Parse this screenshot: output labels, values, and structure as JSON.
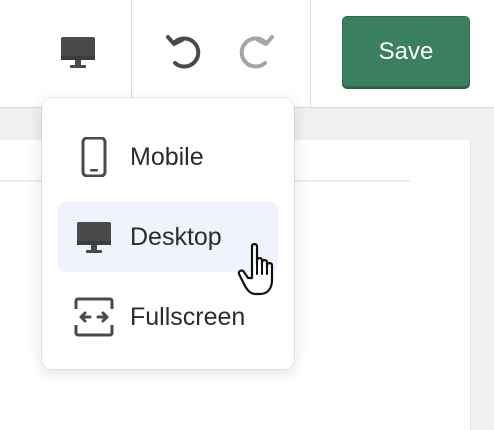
{
  "toolbar": {
    "device_icon": "desktop-icon",
    "undo_icon": "undo-icon",
    "redo_icon": "redo-icon",
    "save_label": "Save"
  },
  "device_menu": {
    "items": [
      {
        "label": "Mobile",
        "icon": "mobile-icon",
        "selected": false
      },
      {
        "label": "Desktop",
        "icon": "desktop-icon",
        "selected": true
      },
      {
        "label": "Fullscreen",
        "icon": "fullscreen-icon",
        "selected": false
      }
    ]
  },
  "colors": {
    "save_button": "#3a7f5e",
    "selected_indicator": "#3a6fd8",
    "selected_bg": "#eef3fc",
    "icon": "#4a4a4d"
  }
}
